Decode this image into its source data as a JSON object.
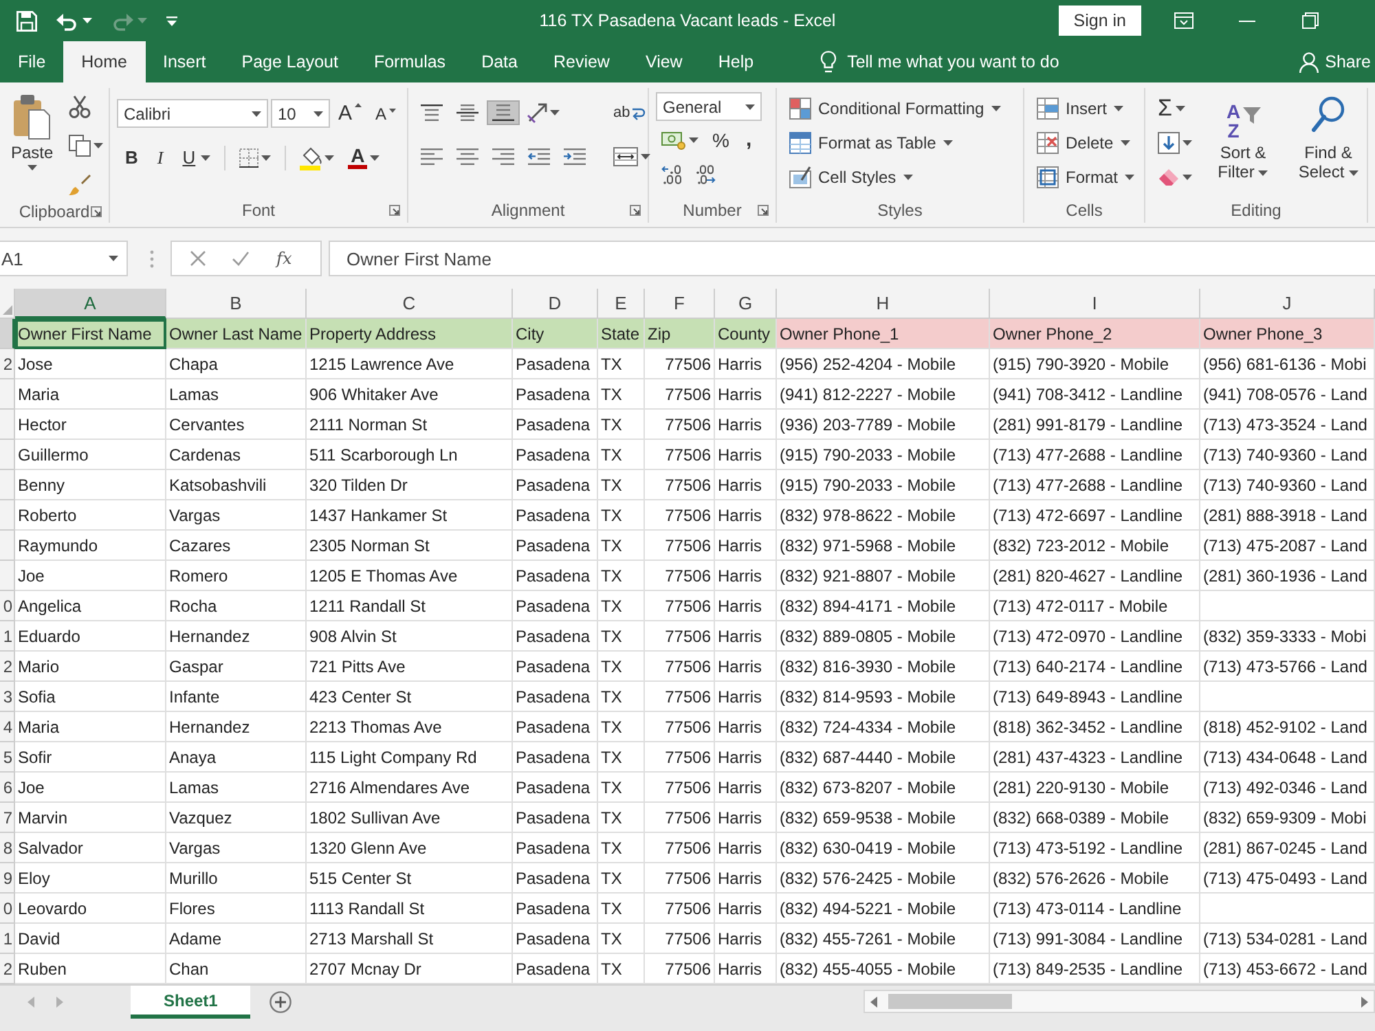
{
  "window": {
    "title": "116 TX Pasadena Vacant leads - Excel",
    "sign_in": "Sign in"
  },
  "quick_access": [
    {
      "kind": "save",
      "disabled": false
    },
    {
      "kind": "undo",
      "disabled": false
    },
    {
      "kind": "redo",
      "disabled": true
    },
    {
      "kind": "customize",
      "disabled": false
    }
  ],
  "ribbon_tabs": [
    {
      "label": "File",
      "selected": false
    },
    {
      "label": "Home",
      "selected": true
    },
    {
      "label": "Insert",
      "selected": false
    },
    {
      "label": "Page Layout",
      "selected": false
    },
    {
      "label": "Formulas",
      "selected": false
    },
    {
      "label": "Data",
      "selected": false
    },
    {
      "label": "Review",
      "selected": false
    },
    {
      "label": "View",
      "selected": false
    },
    {
      "label": "Help",
      "selected": false
    }
  ],
  "tell_me": "Tell me what you want to do",
  "share": "Share",
  "ribbon": [
    {
      "kind": "clipboard",
      "name": "Clipboard",
      "launcher": true,
      "paste": "Paste"
    },
    {
      "kind": "font",
      "name": "Font",
      "launcher": true,
      "font_name": "Calibri",
      "font_size": "10",
      "grow": "A",
      "shrink": "A",
      "toggles": [
        {
          "kind": "bold",
          "label": "B",
          "selected": false
        },
        {
          "kind": "italic",
          "label": "I",
          "selected": false
        },
        {
          "kind": "underline",
          "label": "U",
          "selected": false
        }
      ],
      "font_color": "A"
    },
    {
      "kind": "alignment",
      "name": "Alignment",
      "launcher": true,
      "buttons": [
        {
          "kind": "top_align",
          "selected": false
        },
        {
          "kind": "middle_align",
          "selected": false
        },
        {
          "kind": "bottom_align",
          "selected": true
        },
        {
          "kind": "orientation",
          "selected": false
        },
        {
          "kind": "align_left",
          "selected": false
        },
        {
          "kind": "center",
          "selected": false
        },
        {
          "kind": "align_right",
          "selected": false
        },
        {
          "kind": "decrease_indent",
          "selected": false
        },
        {
          "kind": "increase_indent",
          "selected": false
        }
      ],
      "wrap_glyph": "ab"
    },
    {
      "kind": "number",
      "name": "Number",
      "launcher": true,
      "format": "General",
      "percent": "%",
      "comma": ","
    },
    {
      "kind": "styles",
      "name": "Styles",
      "commands": [
        {
          "kind": "conditional_formatting",
          "label": "Conditional Formatting"
        },
        {
          "kind": "format_as_table",
          "label": "Format as Table"
        },
        {
          "kind": "cell_styles",
          "label": "Cell Styles"
        }
      ]
    },
    {
      "kind": "cells",
      "name": "Cells",
      "commands": [
        {
          "kind": "insert",
          "label": "Insert"
        },
        {
          "kind": "delete",
          "label": "Delete"
        },
        {
          "kind": "format",
          "label": "Format"
        }
      ]
    },
    {
      "kind": "editing",
      "name": "Editing",
      "tools": [
        {
          "kind": "autosum",
          "glyph": "Σ"
        },
        {
          "kind": "fill"
        },
        {
          "kind": "clear"
        }
      ],
      "sort": {
        "glyph": "AZ",
        "label": "Sort & Filter"
      },
      "find": {
        "label": "Find & Select"
      }
    }
  ],
  "formula_bar": {
    "name_box": "A1",
    "function_label": "fx",
    "content": "Owner First Name"
  },
  "sheet": {
    "columns": [
      {
        "letter": "A",
        "kind": "text",
        "selected": true
      },
      {
        "letter": "B",
        "kind": "text",
        "selected": false
      },
      {
        "letter": "C",
        "kind": "text",
        "selected": false
      },
      {
        "letter": "D",
        "kind": "text",
        "selected": false
      },
      {
        "letter": "E",
        "kind": "text",
        "selected": false
      },
      {
        "letter": "F",
        "kind": "number",
        "selected": false
      },
      {
        "letter": "G",
        "kind": "text",
        "selected": false
      },
      {
        "letter": "H",
        "kind": "text",
        "selected": false
      },
      {
        "letter": "I",
        "kind": "text",
        "selected": false
      },
      {
        "letter": "J",
        "kind": "text",
        "selected": false
      }
    ],
    "header_row": {
      "selected": true,
      "cells": [
        {
          "text": "Owner First Name",
          "color": "#c6e0b4",
          "selected": true
        },
        {
          "text": "Owner Last Name",
          "color": "#c6e0b4",
          "selected": false
        },
        {
          "text": "Property Address",
          "color": "#c6e0b4",
          "selected": false
        },
        {
          "text": "City",
          "color": "#c6e0b4",
          "selected": false
        },
        {
          "text": "State",
          "color": "#c6e0b4",
          "selected": false
        },
        {
          "text": "Zip",
          "color": "#c6e0b4",
          "selected": false
        },
        {
          "text": "County",
          "color": "#c6e0b4",
          "selected": false
        },
        {
          "text": "Owner Phone_1",
          "color": "#f4cccc",
          "selected": false
        },
        {
          "text": "Owner Phone_2",
          "color": "#f4cccc",
          "selected": false
        },
        {
          "text": "Owner Phone_3",
          "color": "#f4cccc",
          "selected": false
        }
      ]
    },
    "rows": [
      {
        "label": "2",
        "selected": false,
        "cells": [
          "Jose",
          "Chapa",
          "1215 Lawrence Ave",
          "Pasadena",
          "TX",
          "77506",
          "Harris",
          "(956) 252-4204 - Mobile",
          "(915) 790-3920 - Mobile",
          "(956) 681-6136 - Mobi"
        ]
      },
      {
        "selected": false,
        "cells": [
          "Maria",
          "Lamas",
          "906 Whitaker Ave",
          "Pasadena",
          "TX",
          "77506",
          "Harris",
          "(941) 812-2227 - Mobile",
          "(941) 708-3412 - Landline",
          "(941) 708-0576 - Land"
        ]
      },
      {
        "selected": false,
        "cells": [
          "Hector",
          "Cervantes",
          "2111 Norman St",
          "Pasadena",
          "TX",
          "77506",
          "Harris",
          "(936) 203-7789 - Mobile",
          "(281) 991-8179 - Landline",
          "(713) 473-3524 - Land"
        ]
      },
      {
        "selected": false,
        "cells": [
          "Guillermo",
          "Cardenas",
          "511 Scarborough Ln",
          "Pasadena",
          "TX",
          "77506",
          "Harris",
          "(915) 790-2033 - Mobile",
          "(713) 477-2688 - Landline",
          "(713) 740-9360 - Land"
        ]
      },
      {
        "selected": false,
        "cells": [
          "Benny",
          "Katsobashvili",
          "320 Tilden Dr",
          "Pasadena",
          "TX",
          "77506",
          "Harris",
          "(915) 790-2033 - Mobile",
          "(713) 477-2688 - Landline",
          "(713) 740-9360 - Land"
        ]
      },
      {
        "selected": false,
        "cells": [
          "Roberto",
          "Vargas",
          "1437 Hankamer St",
          "Pasadena",
          "TX",
          "77506",
          "Harris",
          "(832) 978-8622 - Mobile",
          "(713) 472-6697 - Landline",
          "(281) 888-3918 - Land"
        ]
      },
      {
        "selected": false,
        "cells": [
          "Raymundo",
          "Cazares",
          "2305 Norman St",
          "Pasadena",
          "TX",
          "77506",
          "Harris",
          "(832) 971-5968 - Mobile",
          "(832) 723-2012 - Mobile",
          "(713) 475-2087 - Land"
        ]
      },
      {
        "selected": false,
        "cells": [
          "Joe",
          "Romero",
          "1205 E Thomas Ave",
          "Pasadena",
          "TX",
          "77506",
          "Harris",
          "(832) 921-8807 - Mobile",
          "(281) 820-4627 - Landline",
          "(281) 360-1936 - Land"
        ]
      },
      {
        "label": "0",
        "selected": false,
        "cells": [
          "Angelica",
          "Rocha",
          "1211 Randall St",
          "Pasadena",
          "TX",
          "77506",
          "Harris",
          "(832) 894-4171 - Mobile",
          "(713) 472-0117 - Mobile"
        ]
      },
      {
        "label": "1",
        "selected": false,
        "cells": [
          "Eduardo",
          "Hernandez",
          "908 Alvin St",
          "Pasadena",
          "TX",
          "77506",
          "Harris",
          "(832) 889-0805 - Mobile",
          "(713) 472-0970 - Landline",
          "(832) 359-3333 - Mobi"
        ]
      },
      {
        "label": "2",
        "selected": false,
        "cells": [
          "Mario",
          "Gaspar",
          "721 Pitts Ave",
          "Pasadena",
          "TX",
          "77506",
          "Harris",
          "(832) 816-3930 - Mobile",
          "(713) 640-2174 - Landline",
          "(713) 473-5766 - Land"
        ]
      },
      {
        "label": "3",
        "selected": false,
        "cells": [
          "Sofia",
          "Infante",
          "423 Center St",
          "Pasadena",
          "TX",
          "77506",
          "Harris",
          "(832) 814-9593 - Mobile",
          "(713) 649-8943 - Landline"
        ]
      },
      {
        "label": "4",
        "selected": false,
        "cells": [
          "Maria",
          "Hernandez",
          "2213 Thomas Ave",
          "Pasadena",
          "TX",
          "77506",
          "Harris",
          "(832) 724-4334 - Mobile",
          "(818) 362-3452 - Landline",
          "(818) 452-9102 - Land"
        ]
      },
      {
        "label": "5",
        "selected": false,
        "cells": [
          "Sofir",
          "Anaya",
          "115 Light Company Rd",
          "Pasadena",
          "TX",
          "77506",
          "Harris",
          "(832) 687-4440 - Mobile",
          "(281) 437-4323 - Landline",
          "(713) 434-0648 - Land"
        ]
      },
      {
        "label": "6",
        "selected": false,
        "cells": [
          "Joe",
          "Lamas",
          "2716 Almendares Ave",
          "Pasadena",
          "TX",
          "77506",
          "Harris",
          "(832) 673-8207 - Mobile",
          "(281) 220-9130 - Mobile",
          "(713) 492-0346 - Land"
        ]
      },
      {
        "label": "7",
        "selected": false,
        "cells": [
          "Marvin",
          "Vazquez",
          "1802 Sullivan Ave",
          "Pasadena",
          "TX",
          "77506",
          "Harris",
          "(832) 659-9538 - Mobile",
          "(832) 668-0389 - Mobile",
          "(832) 659-9309 - Mobi"
        ]
      },
      {
        "label": "8",
        "selected": false,
        "cells": [
          "Salvador",
          "Vargas",
          "1320 Glenn Ave",
          "Pasadena",
          "TX",
          "77506",
          "Harris",
          "(832) 630-0419 - Mobile",
          "(713) 473-5192 - Landline",
          "(281) 867-0245 - Land"
        ]
      },
      {
        "label": "9",
        "selected": false,
        "cells": [
          "Eloy",
          "Murillo",
          "515 Center St",
          "Pasadena",
          "TX",
          "77506",
          "Harris",
          "(832) 576-2425 - Mobile",
          "(832) 576-2626 - Mobile",
          "(713) 475-0493 - Land"
        ]
      },
      {
        "label": "0",
        "selected": false,
        "cells": [
          "Leovardo",
          "Flores",
          "1113 Randall St",
          "Pasadena",
          "TX",
          "77506",
          "Harris",
          "(832) 494-5221 - Mobile",
          "(713) 473-0114 - Landline"
        ]
      },
      {
        "label": "1",
        "selected": false,
        "cells": [
          "David",
          "Adame",
          "2713 Marshall St",
          "Pasadena",
          "TX",
          "77506",
          "Harris",
          "(832) 455-7261 - Mobile",
          "(713) 991-3084 - Landline",
          "(713) 534-0281 - Land"
        ]
      },
      {
        "label": "2",
        "selected": false,
        "cells": [
          "Ruben",
          "Chan",
          "2707 Mcnay Dr",
          "Pasadena",
          "TX",
          "77506",
          "Harris",
          "(832) 455-4055 - Mobile",
          "(713) 849-2535 - Landline",
          "(713) 453-6672 - Land"
        ]
      }
    ]
  },
  "sheet_tabs": [
    {
      "label": "Sheet1",
      "selected": true
    }
  ]
}
